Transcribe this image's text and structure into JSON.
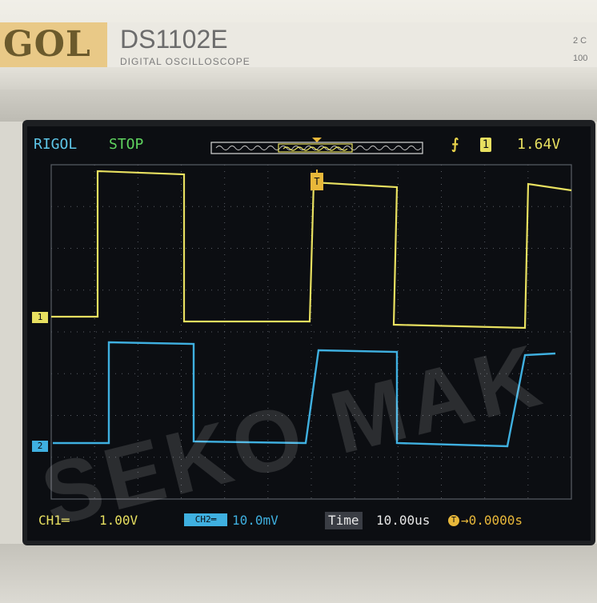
{
  "device": {
    "brand": "GOL",
    "model": "DS1102E",
    "subtitle": "DIGITAL OSCILLOSCOPE",
    "spec_line1": "2 C",
    "spec_line2": "100"
  },
  "screen": {
    "brand": "RIGOL",
    "run_status": "STOP",
    "trigger_edge_icon": "rising-edge-icon",
    "trigger_channel_icon": "1",
    "trigger_level": "1.64V",
    "trigger_marker": "T",
    "ch1_marker": "1",
    "ch2_marker": "2",
    "colors": {
      "ch1": "#e8e060",
      "ch2": "#3fb0e0",
      "grid": "#5a5e66",
      "trigger": "#e8b83a"
    },
    "footer": {
      "ch1_label": "CH1═",
      "ch1_scale": "1.00V",
      "ch2_icon": "CH2═",
      "ch2_scale": "10.0mV",
      "time_label": "Time",
      "time_scale": "10.00us",
      "offset_icon": "T",
      "offset_value": "→0.0000s"
    }
  },
  "watermark": "SEKO MAK"
}
